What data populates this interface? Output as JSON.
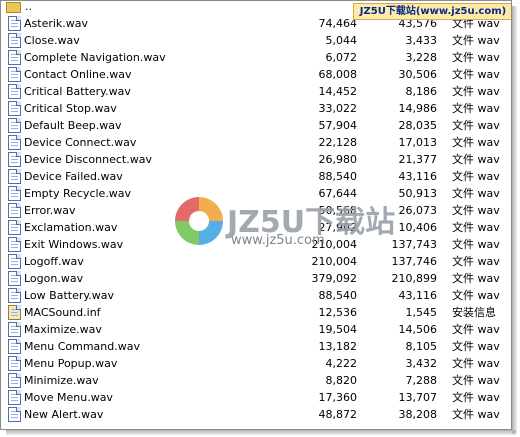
{
  "parent_folder": {
    "label": ".."
  },
  "watermark": {
    "top_banner": "JZ5U下载站(www.jz5u.com)",
    "logo_text": "JZ5U下载站",
    "logo_url": "www.jz5u.com"
  },
  "files": [
    {
      "name": "Asterik.wav",
      "size": "74,464",
      "compressed": "43,576",
      "type": "文件 wav",
      "icon": "wav-file-icon"
    },
    {
      "name": "Close.wav",
      "size": "5,044",
      "compressed": "3,433",
      "type": "文件 wav",
      "icon": "wav-file-icon"
    },
    {
      "name": "Complete Navigation.wav",
      "size": "6,072",
      "compressed": "3,228",
      "type": "文件 wav",
      "icon": "wav-file-icon"
    },
    {
      "name": "Contact Online.wav",
      "size": "68,008",
      "compressed": "30,506",
      "type": "文件 wav",
      "icon": "wav-file-icon"
    },
    {
      "name": "Critical Battery.wav",
      "size": "14,452",
      "compressed": "8,186",
      "type": "文件 wav",
      "icon": "wav-file-icon"
    },
    {
      "name": "Critical Stop.wav",
      "size": "33,022",
      "compressed": "14,986",
      "type": "文件 wav",
      "icon": "wav-file-icon"
    },
    {
      "name": "Default Beep.wav",
      "size": "57,904",
      "compressed": "28,035",
      "type": "文件 wav",
      "icon": "wav-file-icon"
    },
    {
      "name": "Device Connect.wav",
      "size": "22,128",
      "compressed": "17,013",
      "type": "文件 wav",
      "icon": "wav-file-icon"
    },
    {
      "name": "Device Disconnect.wav",
      "size": "26,980",
      "compressed": "21,377",
      "type": "文件 wav",
      "icon": "wav-file-icon"
    },
    {
      "name": "Device Failed.wav",
      "size": "88,540",
      "compressed": "43,116",
      "type": "文件 wav",
      "icon": "wav-file-icon"
    },
    {
      "name": "Empty Recycle.wav",
      "size": "67,644",
      "compressed": "50,913",
      "type": "文件 wav",
      "icon": "wav-file-icon"
    },
    {
      "name": "Error.wav",
      "size": "50,568",
      "compressed": "26,073",
      "type": "文件 wav",
      "icon": "wav-file-icon"
    },
    {
      "name": "Exclamation.wav",
      "size": "27,902",
      "compressed": "10,406",
      "type": "文件 wav",
      "icon": "wav-file-icon"
    },
    {
      "name": "Exit Windows.wav",
      "size": "210,004",
      "compressed": "137,743",
      "type": "文件 wav",
      "icon": "wav-file-icon"
    },
    {
      "name": "Logoff.wav",
      "size": "210,004",
      "compressed": "137,746",
      "type": "文件 wav",
      "icon": "wav-file-icon"
    },
    {
      "name": "Logon.wav",
      "size": "379,092",
      "compressed": "210,899",
      "type": "文件 wav",
      "icon": "wav-file-icon"
    },
    {
      "name": "Low Battery.wav",
      "size": "88,540",
      "compressed": "43,116",
      "type": "文件 wav",
      "icon": "wav-file-icon"
    },
    {
      "name": "MACSound.inf",
      "size": "12,536",
      "compressed": "1,545",
      "type": "安装信息",
      "icon": "inf-file-icon"
    },
    {
      "name": "Maximize.wav",
      "size": "19,504",
      "compressed": "14,506",
      "type": "文件 wav",
      "icon": "wav-file-icon"
    },
    {
      "name": "Menu Command.wav",
      "size": "13,182",
      "compressed": "8,105",
      "type": "文件 wav",
      "icon": "wav-file-icon"
    },
    {
      "name": "Menu Popup.wav",
      "size": "4,222",
      "compressed": "3,432",
      "type": "文件 wav",
      "icon": "wav-file-icon"
    },
    {
      "name": "Minimize.wav",
      "size": "8,820",
      "compressed": "7,288",
      "type": "文件 wav",
      "icon": "wav-file-icon"
    },
    {
      "name": "Move Menu.wav",
      "size": "17,360",
      "compressed": "13,707",
      "type": "文件 wav",
      "icon": "wav-file-icon"
    },
    {
      "name": "New Alert.wav",
      "size": "48,872",
      "compressed": "38,208",
      "type": "文件 wav",
      "icon": "wav-file-icon"
    }
  ]
}
